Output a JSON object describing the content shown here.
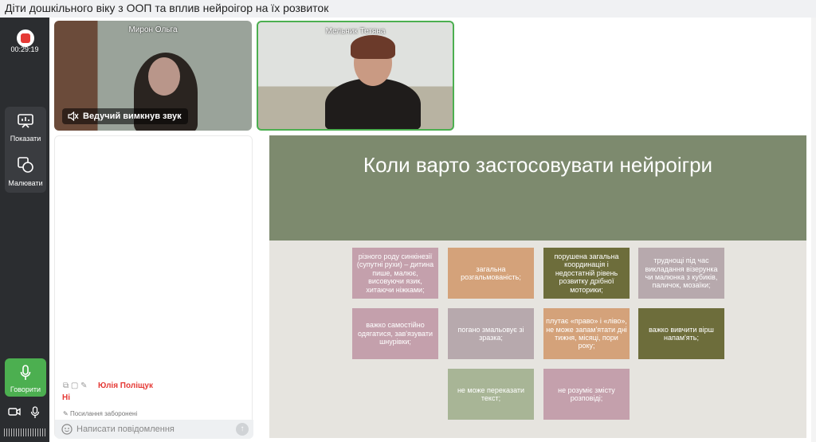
{
  "window": {
    "title": "Діти дошкільного віку з ООП та вплив нейроігор на їх розвиток"
  },
  "recording": {
    "timer": "00:29:19"
  },
  "controls": {
    "show_label": "Показати",
    "draw_label": "Малювати",
    "speak_label": "Говорити"
  },
  "participants": [
    {
      "name": "Мирон Ольга",
      "status": "Ведучий вимкнув звук"
    },
    {
      "name": "Мельник Тетяна"
    }
  ],
  "chat": {
    "author": "Юлія Поліщук",
    "message": "Ні",
    "links_notice": "Посилання заборонені",
    "input_placeholder": "Написати повідомлення"
  },
  "slide": {
    "title": "Коли варто застосовувати нейроігри",
    "boxes": [
      "різного роду синкінезії (супутні рухи) – дитина пише, малює, висовуючи язик, хитаючи ніжками;",
      "загальна розгальмованість;",
      "порушена загальна координація і недостатній рівень розвитку дрібної моторики;",
      "труднощі під час викладання візерунка чи малюнка з кубиків, паличок, мозаїки;",
      "важко самостійно одягатися, зав'язувати шнурівки;",
      "погано змальовує зі зразка;",
      "плутає «право» і «ліво», не може запам'ятати дні тижня, місяці, пори року;",
      "важко вивчити вірш напам'ять;",
      "не може переказати текст;",
      "не розуміє змісту розповіді;"
    ]
  },
  "colors": {
    "slide_header": "#7d8a6e",
    "pink": "#c4a0ac",
    "orange": "#d4a27a",
    "olive": "#6d6d3b",
    "gray": "#b7a9ad",
    "sage": "#a8b596",
    "accent_green": "#4caf50",
    "record_red": "#e53935"
  }
}
